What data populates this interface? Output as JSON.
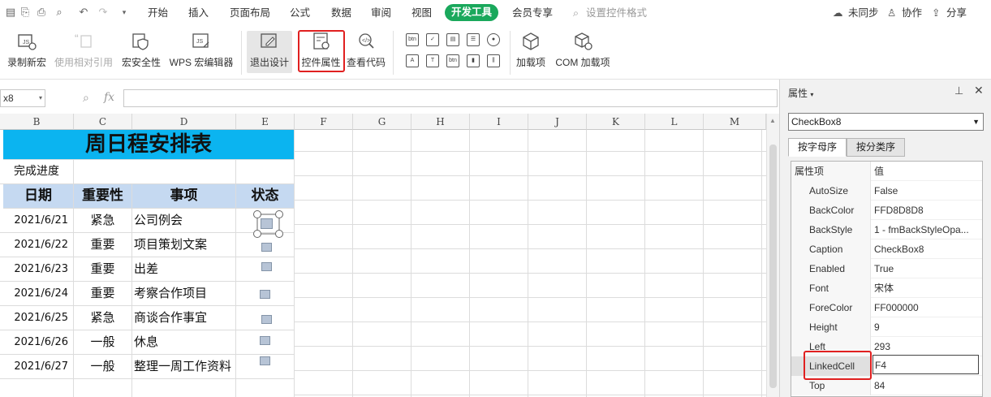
{
  "menubar": {
    "items": [
      "开始",
      "插入",
      "页面布局",
      "公式",
      "数据",
      "审阅",
      "视图"
    ],
    "active": "开发工具",
    "after": "会员专享",
    "search_placeholder": "设置控件格式",
    "right": {
      "sync": "未同步",
      "collab": "协作",
      "share": "分享"
    }
  },
  "ribbon": {
    "record_macro": "录制新宏",
    "relative_ref": "使用相对引用",
    "macro_security": "宏安全性",
    "wps_macro_editor": "WPS 宏编辑器",
    "exit_design": "退出设计",
    "control_properties": "控件属性",
    "view_code": "查看代码",
    "addins": "加载项",
    "com_addins": "COM 加载项"
  },
  "formula_bar": {
    "namebox": "x8",
    "fx": "fx",
    "content": ""
  },
  "columns": [
    "B",
    "C",
    "D",
    "E",
    "F",
    "G",
    "H",
    "I",
    "J",
    "K",
    "L",
    "M"
  ],
  "sheet": {
    "title": "周日程安排表",
    "progress_label": "完成进度",
    "headers": [
      "日期",
      "重要性",
      "事项",
      "状态"
    ],
    "rows": [
      {
        "date": "2021/6/21",
        "priority": "紧急",
        "task": "公司例会"
      },
      {
        "date": "2021/6/22",
        "priority": "重要",
        "task": "项目策划文案"
      },
      {
        "date": "2021/6/23",
        "priority": "重要",
        "task": "出差"
      },
      {
        "date": "2021/6/24",
        "priority": "重要",
        "task": "考察合作项目"
      },
      {
        "date": "2021/6/25",
        "priority": "紧急",
        "task": "商谈合作事宜"
      },
      {
        "date": "2021/6/26",
        "priority": "一般",
        "task": "休息"
      },
      {
        "date": "2021/6/27",
        "priority": "一般",
        "task": "整理一周工作资料"
      }
    ]
  },
  "panel": {
    "title": "属性",
    "object": "CheckBox8",
    "tabs": [
      "按字母序",
      "按分类序"
    ],
    "col_headers": {
      "name": "属性项",
      "value": "值"
    },
    "props": [
      {
        "name": "AutoSize",
        "value": "False"
      },
      {
        "name": "BackColor",
        "value": "FFD8D8D8"
      },
      {
        "name": "BackStyle",
        "value": "1 - fmBackStyleOpa..."
      },
      {
        "name": "Caption",
        "value": "CheckBox8"
      },
      {
        "name": "Enabled",
        "value": "True"
      },
      {
        "name": "Font",
        "value": "宋体"
      },
      {
        "name": "ForeColor",
        "value": "FF000000"
      },
      {
        "name": "Height",
        "value": "9"
      },
      {
        "name": "Left",
        "value": "293"
      },
      {
        "name": "LinkedCell",
        "value": "F4"
      },
      {
        "name": "Top",
        "value": "84"
      }
    ]
  },
  "colors": {
    "accent": "#1aa85c",
    "title_bg": "#0bb4f0",
    "header_bg": "#c5d9f1",
    "highlight": "#e02020"
  }
}
